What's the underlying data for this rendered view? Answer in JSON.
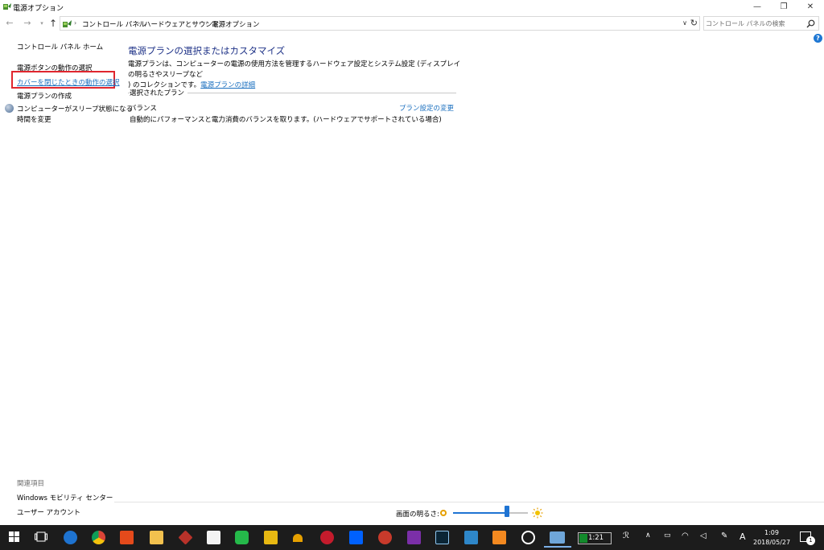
{
  "window": {
    "title": "電源オプション",
    "minimize_glyph": "—",
    "restore_glyph": "❐",
    "close_glyph": "✕"
  },
  "address_bar": {
    "breadcrumbs": [
      "コントロール パネル",
      "ハードウェアとサウンド",
      "電源オプション"
    ],
    "search_placeholder": "コントロール パネルの検索"
  },
  "help_glyph": "?",
  "sidebar": {
    "home": "コントロール パネル ホーム",
    "items": [
      "電源ボタンの動作の選択",
      "カバーを閉じたときの動作の選択",
      "電源プランの作成",
      "コンピューターがスリープ状態になる",
      "時間を変更"
    ],
    "related_header": "関連項目",
    "related": [
      "Windows モビリティ センター",
      "ユーザー アカウント"
    ]
  },
  "main": {
    "title": "電源プランの選択またはカスタマイズ",
    "desc_line1": "電源プランは、コンピューターの電源の使用方法を管理するハードウェア設定とシステム設定 (ディスプレイの明るさやスリープなど",
    "desc_line2": ") のコレクションです。",
    "desc_link": "電源プランの詳細",
    "section_header": "選択されたプラン",
    "plan_name": "バランス",
    "plan_desc": "自動的にパフォーマンスと電力消費のバランスを取ります。(ハードウェアでサポートされている場合)",
    "plan_change_link": "プラン設定の変更"
  },
  "brightness": {
    "label": "画面の明るさ:",
    "level_fraction": 0.72
  },
  "taskbar": {
    "battery_text": "1:21",
    "battery_fraction": 0.25,
    "ime": "A",
    "time": "1:09",
    "date": "2018/05/27",
    "notif_count": "1"
  },
  "colors": {
    "accent": "#1f74d3",
    "link": "#1a6fbf",
    "highlight_box": "#e0262e",
    "title_blue": "#1e3287"
  }
}
